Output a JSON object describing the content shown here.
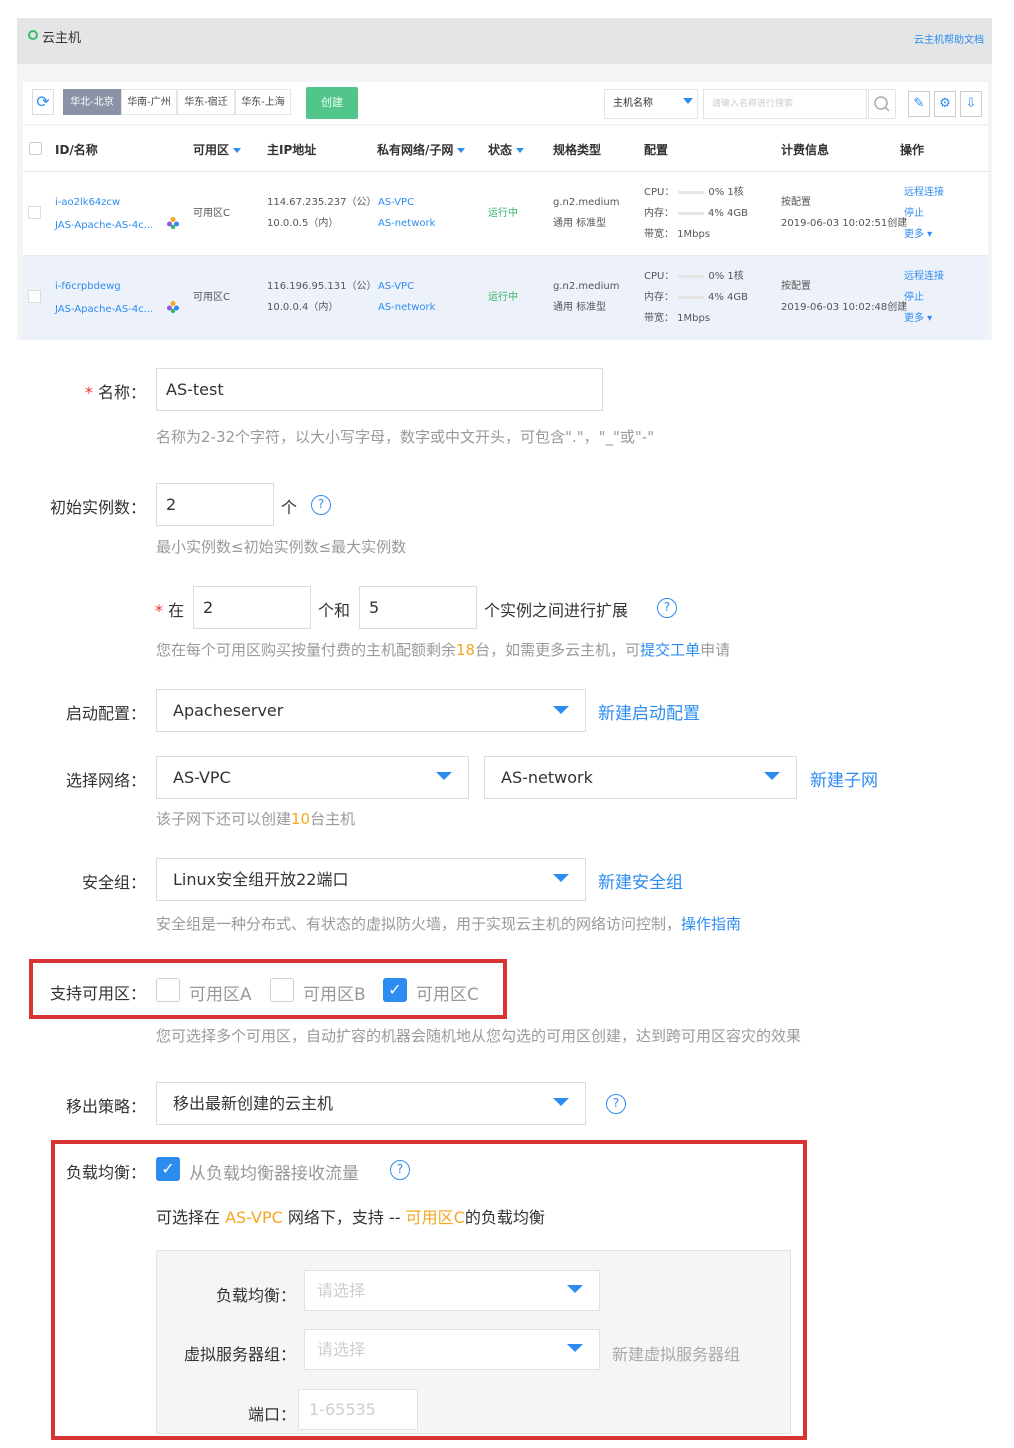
{
  "header": {
    "title": "云主机",
    "help_link": "云主机帮助文档"
  },
  "toolbar": {
    "regions": [
      "华北-北京",
      "华南-广州",
      "华东-宿迁",
      "华东-上海"
    ],
    "active_region": "华北-北京",
    "create_label": "创建",
    "search_type": "主机名称",
    "search_placeholder": "请输入名称进行搜索"
  },
  "table": {
    "columns": [
      "ID/名称",
      "可用区",
      "主IP地址",
      "私有网络/子网",
      "状态",
      "规格类型",
      "配置",
      "计费信息",
      "操作"
    ],
    "rows": [
      {
        "id": "i-ao2lk64zcw",
        "name": "JAS-Apache-AS-4c...",
        "zone": "可用区C",
        "ip_public": "114.67.235.237（公）",
        "ip_private": "10.0.0.5（内）",
        "vpc": "AS-VPC",
        "subnet": "AS-network",
        "status": "运行中",
        "spec": "g.n2.medium",
        "spec_type": "通用 标准型",
        "cpu_label": "CPU：",
        "cpu": "0% 1核",
        "mem_label": "内存：",
        "mem": "4% 4GB",
        "bandwidth": "带宽： 1Mbps",
        "billing": "按配置",
        "created": "2019-06-03 10:02:51创建",
        "actions": [
          "远程连接",
          "停止",
          "更多"
        ]
      },
      {
        "id": "i-f6crpbdewg",
        "name": "JAS-Apache-AS-4c...",
        "zone": "可用区C",
        "ip_public": "116.196.95.131（公）",
        "ip_private": "10.0.0.4（内）",
        "vpc": "AS-VPC",
        "subnet": "AS-network",
        "status": "运行中",
        "spec": "g.n2.medium",
        "spec_type": "通用 标准型",
        "cpu_label": "CPU：",
        "cpu": "0% 1核",
        "mem_label": "内存：",
        "mem": "4% 4GB",
        "bandwidth": "带宽： 1Mbps",
        "billing": "按配置",
        "created": "2019-06-03 10:02:48创建",
        "actions": [
          "远程连接",
          "停止",
          "更多"
        ]
      }
    ]
  },
  "form": {
    "name": {
      "required_mark": "*",
      "label": "名称：",
      "value": "AS-test",
      "hint": "名称为2-32个字符，以大小写字母，数字或中文开头，可包含\".\"，\"_\"或\"-\""
    },
    "initial": {
      "label": "初始实例数：",
      "value": "2",
      "unit": "个",
      "hint": "最小实例数≤初始实例数≤最大实例数"
    },
    "range": {
      "required_mark": "*",
      "prefix": "在",
      "min": "2",
      "and": "个和",
      "max": "5",
      "suffix": "个实例之间进行扩展",
      "hint_before": "您在每个可用区购买按量付费的主机配额剩余",
      "quota": "18",
      "hint_mid": "台，如需更多云主机，可",
      "hint_link": "提交工单",
      "hint_after": "申请"
    },
    "launch": {
      "label": "启动配置：",
      "value": "Apacheserver",
      "link": "新建启动配置"
    },
    "network": {
      "label": "选择网络：",
      "vpc": "AS-VPC",
      "subnet": "AS-network",
      "link": "新建子网",
      "hint_before": "该子网下还可以创建",
      "count": "10",
      "hint_after": "台主机"
    },
    "security": {
      "label": "安全组：",
      "value": "Linux安全组开放22端口",
      "link": "新建安全组",
      "hint": "安全组是一种分布式、有状态的虚拟防火墙，用于实现云主机的网络访问控制，",
      "hint_link": "操作指南"
    },
    "zones": {
      "label": "支持可用区：",
      "options": [
        {
          "label": "可用区A",
          "checked": false
        },
        {
          "label": "可用区B",
          "checked": false
        },
        {
          "label": "可用区C",
          "checked": true
        }
      ],
      "hint": "您可选择多个可用区，自动扩容的机器会随机地从您勾选的可用区创建，达到跨可用区容灾的效果"
    },
    "removal": {
      "label": "移出策略：",
      "value": "移出最新创建的云主机"
    },
    "lb": {
      "label": "负载均衡：",
      "checkbox_label": "从负载均衡器接收流量",
      "desc_before": "可选择在",
      "vpc": "AS-VPC",
      "desc_mid": "网络下，支持 --",
      "zone": "可用区C",
      "desc_after": "的负载均衡",
      "lb_label": "负载均衡：",
      "lb_placeholder": "请选择",
      "group_label": "虚拟服务器组：",
      "group_placeholder": "请选择",
      "group_link": "新建虚拟服务器组",
      "port_label": "端口：",
      "port_placeholder": "1-65535"
    }
  },
  "colors": {
    "accent": "#2d8cf0",
    "success": "#52c58b",
    "highlight": "#d93434",
    "orange": "#f5a623"
  }
}
